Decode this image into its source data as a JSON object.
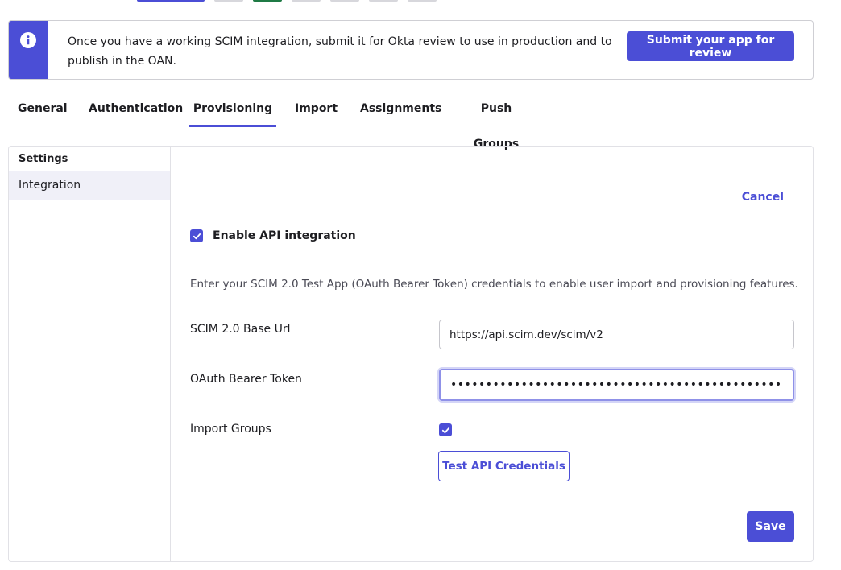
{
  "colors": {
    "accent": "#4b4ed6",
    "border": "#cfcfd4",
    "side_active_bg": "#f0f0f8"
  },
  "banner": {
    "icon": "info-icon",
    "message": "Once you have a working SCIM integration, submit it for Okta review to use in production and to publish in the OAN.",
    "button_label": "Submit your app for review"
  },
  "tabs": [
    {
      "label": "General"
    },
    {
      "label": "Authentication"
    },
    {
      "label": "Provisioning",
      "active": true
    },
    {
      "label": "Import"
    },
    {
      "label": "Assignments"
    },
    {
      "label": "Push Groups"
    }
  ],
  "sidebar": {
    "title": "Settings",
    "items": [
      {
        "label": "Integration",
        "active": true
      }
    ]
  },
  "form": {
    "cancel_label": "Cancel",
    "enable_api_label": "Enable API integration",
    "enable_api_checked": true,
    "description": "Enter your SCIM 2.0 Test App (OAuth Bearer Token) credentials to enable user import and provisioning features.",
    "base_url_label": "SCIM 2.0 Base Url",
    "base_url_value": "https://api.scim.dev/scim/v2",
    "token_label": "OAuth Bearer Token",
    "token_value": "••••••••••••••••••••••••••••••••••••••••••••••••••••••••",
    "import_groups_label": "Import Groups",
    "import_groups_checked": true,
    "test_button_label": "Test API Credentials",
    "save_label": "Save"
  }
}
